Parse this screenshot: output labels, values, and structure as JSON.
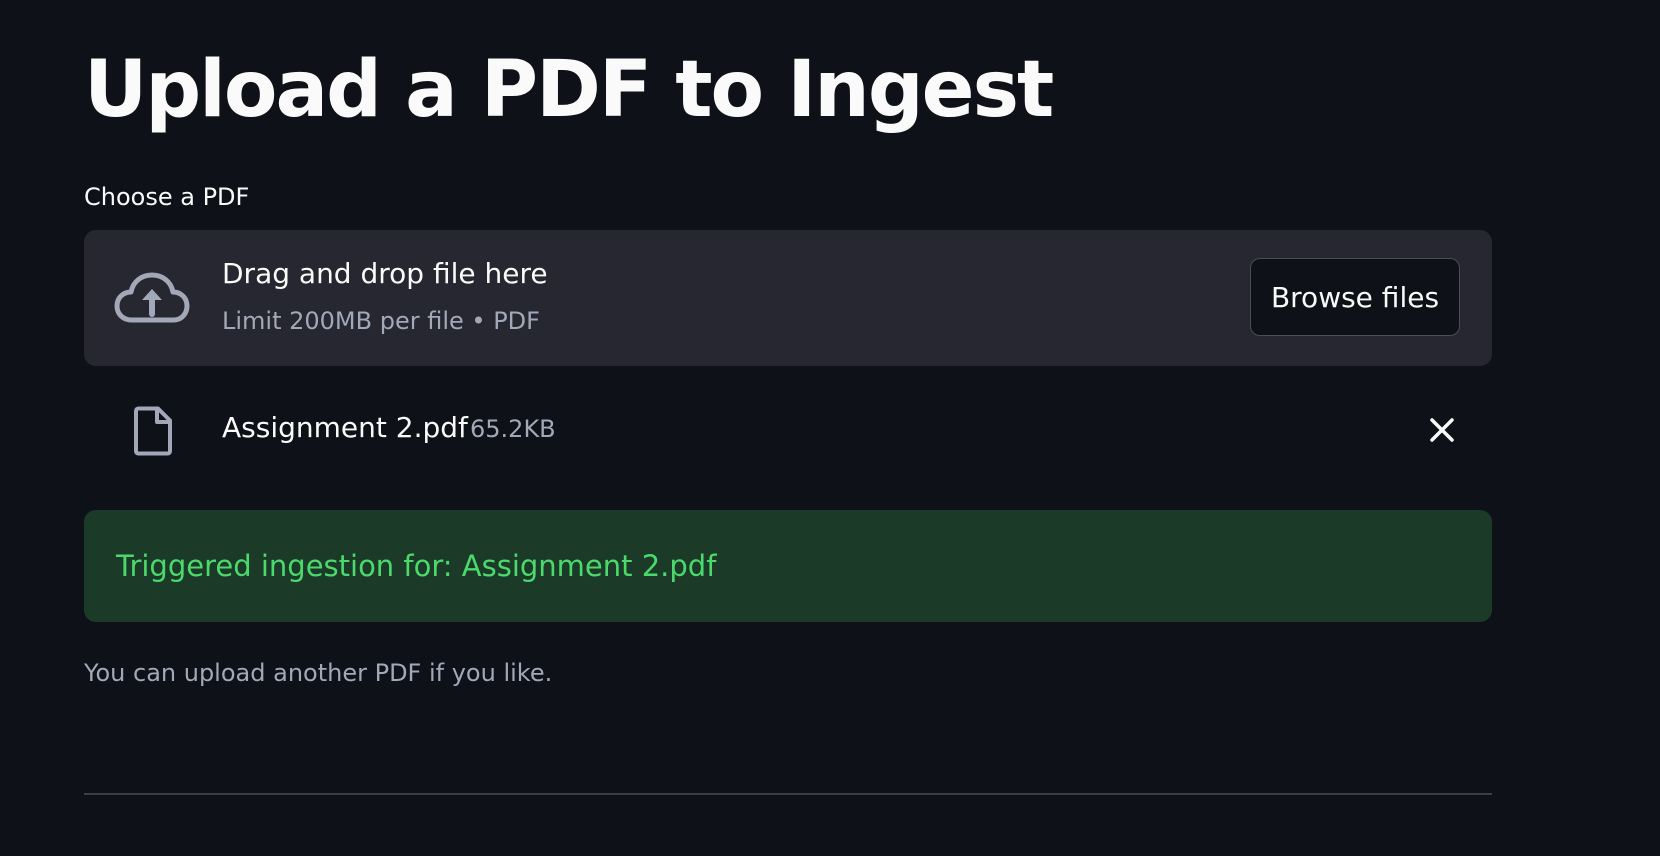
{
  "page": {
    "title": "Upload a PDF to Ingest"
  },
  "uploader": {
    "label": "Choose a PDF",
    "dropzone_title": "Drag and drop file here",
    "dropzone_limit": "Limit 200MB per file • PDF",
    "browse_label": "Browse files",
    "icon": "cloud-upload-icon"
  },
  "uploaded_file": {
    "name": "Assignment 2.pdf",
    "size": "65.2KB",
    "icon": "file-icon",
    "remove_icon": "close-icon"
  },
  "alert": {
    "message": "Triggered ingestion for: Assignment 2.pdf",
    "text_color": "#4bd96c",
    "background": "#1b3a28"
  },
  "info": {
    "message": "You can upload another PDF if you like."
  },
  "theme": {
    "background": "#0e1117",
    "surface": "#262730",
    "text": "#fafafa",
    "muted_text": "#a3a8b8"
  }
}
